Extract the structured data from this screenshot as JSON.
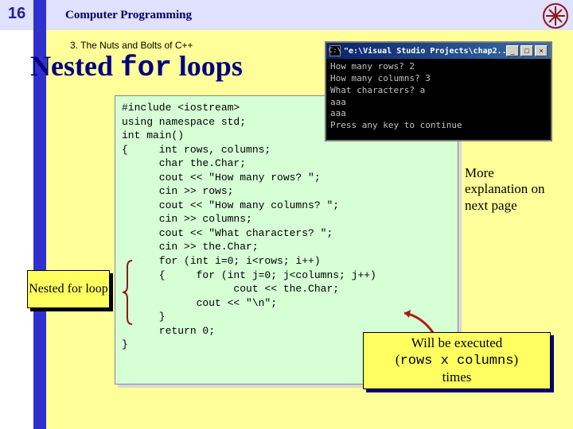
{
  "slide_number": "16",
  "header_title": "Computer Programming",
  "breadcrumb": "3. The Nuts and Bolts of C++",
  "title_pre": "Nested ",
  "title_code": "for",
  "title_post": " loops",
  "code": "#include <iostream>\nusing namespace std;\nint main()\n{     int rows, columns;\n      char the.Char;\n      cout << \"How many rows? \";\n      cin >> rows;\n      cout << \"How many columns? \";\n      cin >> columns;\n      cout << \"What characters? \";\n      cin >> the.Char;\n      for (int i=0; i<rows; i++)\n      {     for (int j=0; j<columns; j++)\n                  cout << the.Char;\n            cout << \"\\n\";\n      }\n      return 0;\n}",
  "nested_label": "Nested for loop",
  "note_right": "More explanation on next page",
  "callout_line1": "Will be executed",
  "callout_line2_pre": "(",
  "callout_line2_code": "rows x columns",
  "callout_line2_post": ")",
  "callout_line3": "times",
  "console": {
    "title": "\"e:\\Visual Studio Projects\\chap2...",
    "lines": "How many rows? 2\nHow many columns? 3\nWhat characters? a\naaa\naaa\nPress any key to continue"
  }
}
